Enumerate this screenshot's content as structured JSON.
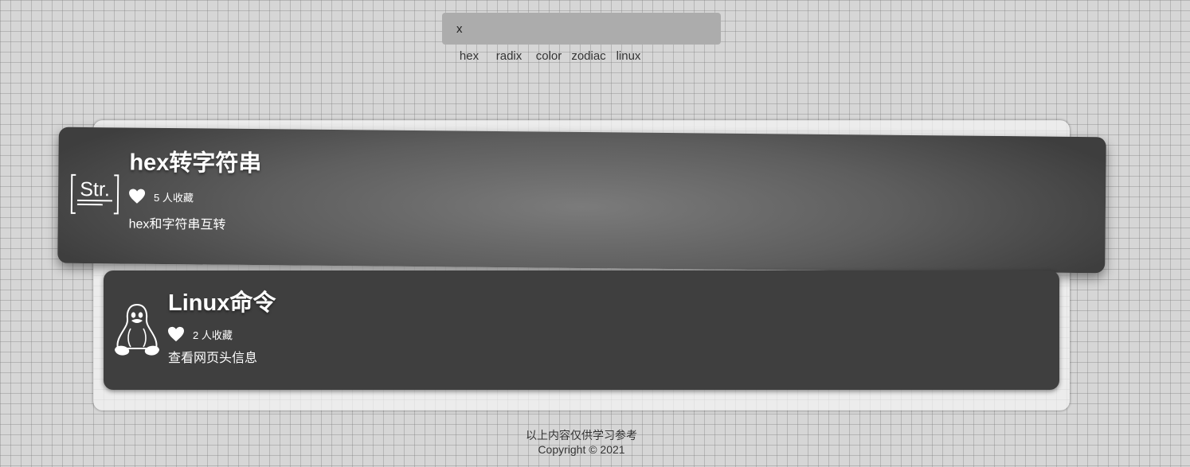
{
  "search": {
    "value": "x",
    "placeholder": ""
  },
  "tags": [
    {
      "label": "hex"
    },
    {
      "label": "radix"
    },
    {
      "label": "color"
    },
    {
      "label": "zodiac"
    },
    {
      "label": "linux"
    }
  ],
  "results": [
    {
      "icon": "str-icon",
      "title": "hex转字符串",
      "fav_count": "5",
      "fav_suffix": "人收藏",
      "description": "hex和字符串互转"
    },
    {
      "icon": "linux-penguin-icon",
      "title": "Linux命令",
      "fav_count": "2",
      "fav_suffix": "人收藏",
      "description": "查看网页头信息"
    }
  ],
  "footer": {
    "line1": "以上内容仅供学习参考",
    "line2": "Copyright © 2021"
  },
  "colors": {
    "page_bg": "#d6d6d6",
    "search_bg": "#acacac",
    "card_dark": "#3f3f3f",
    "card_highlight": "#7b7b7b",
    "text_light": "#ffffff"
  }
}
